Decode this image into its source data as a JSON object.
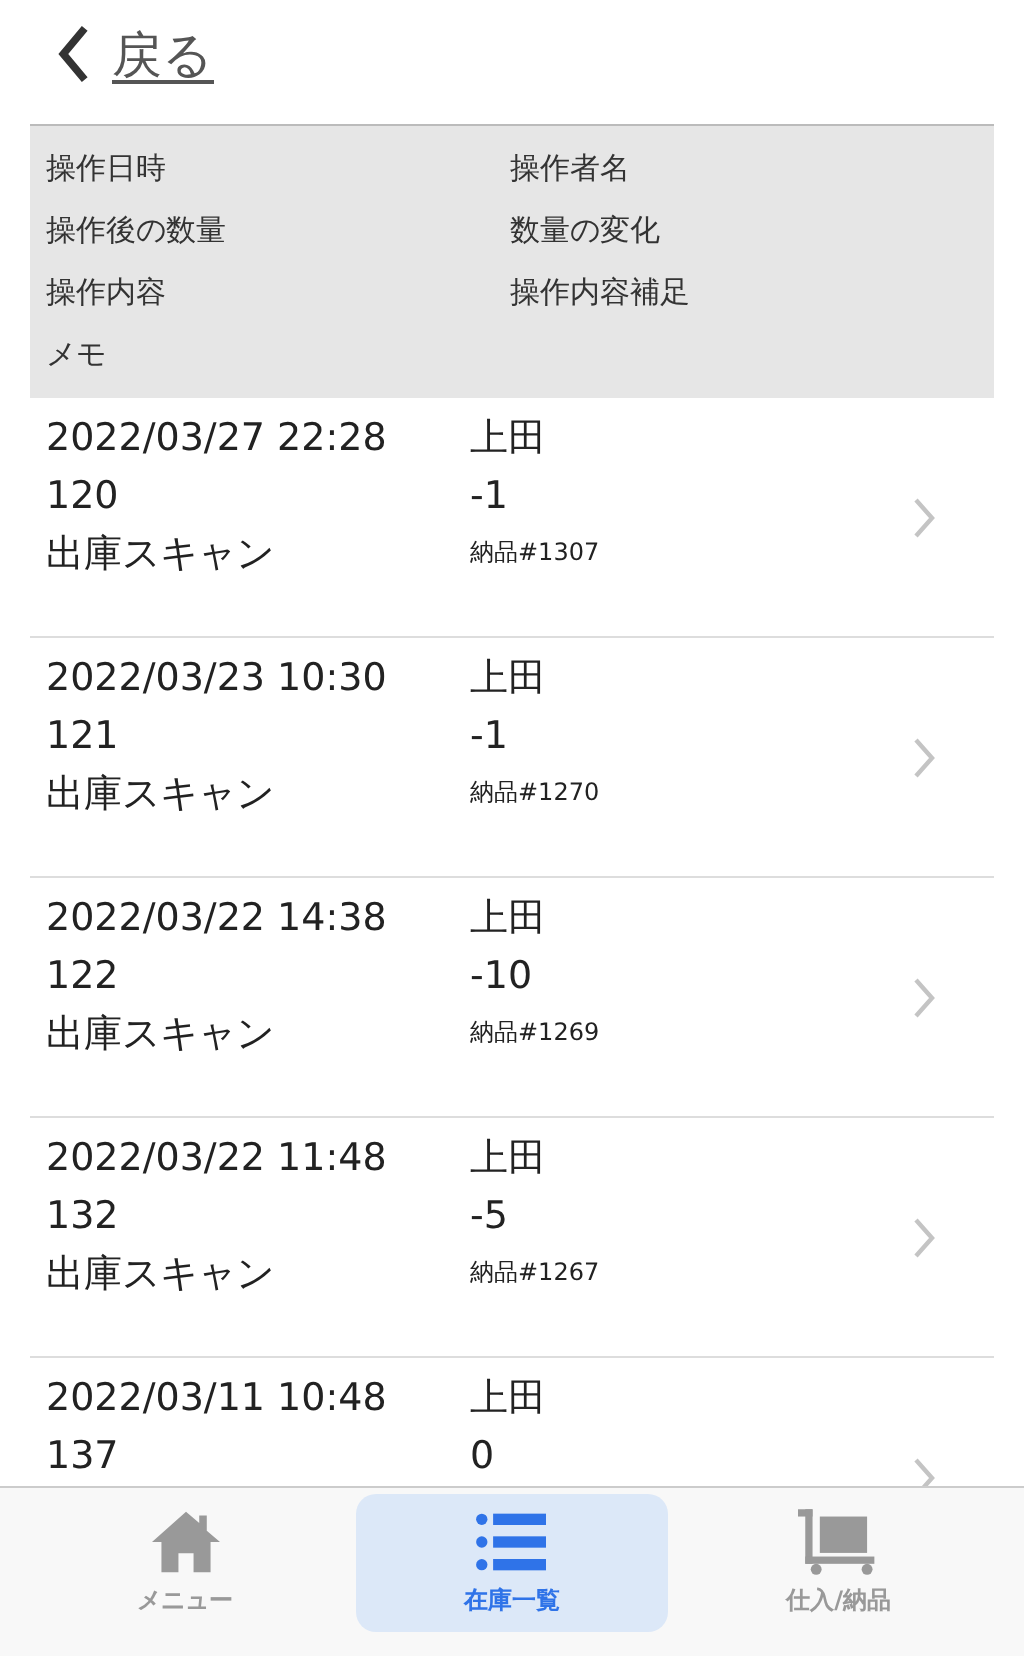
{
  "back": {
    "label": "戻る"
  },
  "header": {
    "columns": [
      [
        "操作日時",
        "操作者名"
      ],
      [
        "操作後の数量",
        "数量の変化"
      ],
      [
        "操作内容",
        "操作内容補足"
      ],
      [
        "メモ"
      ]
    ]
  },
  "rows": [
    {
      "datetime": "2022/03/27 22:28",
      "operator": "上田",
      "quantity": "120",
      "change": "-1",
      "operation": "出庫スキャン",
      "note": "納品#1307"
    },
    {
      "datetime": "2022/03/23 10:30",
      "operator": "上田",
      "quantity": "121",
      "change": "-1",
      "operation": "出庫スキャン",
      "note": "納品#1270"
    },
    {
      "datetime": "2022/03/22 14:38",
      "operator": "上田",
      "quantity": "122",
      "change": "-10",
      "operation": "出庫スキャン",
      "note": "納品#1269"
    },
    {
      "datetime": "2022/03/22 11:48",
      "operator": "上田",
      "quantity": "132",
      "change": "-5",
      "operation": "出庫スキャン",
      "note": "納品#1267"
    },
    {
      "datetime": "2022/03/11 10:48",
      "operator": "上田",
      "quantity": "137",
      "change": "0"
    }
  ],
  "tabs": [
    {
      "label": "メニュー",
      "kind": "home",
      "selected": false
    },
    {
      "label": "在庫一覧",
      "kind": "list",
      "selected": true
    },
    {
      "label": "仕入/納品",
      "kind": "cart",
      "selected": false
    }
  ]
}
